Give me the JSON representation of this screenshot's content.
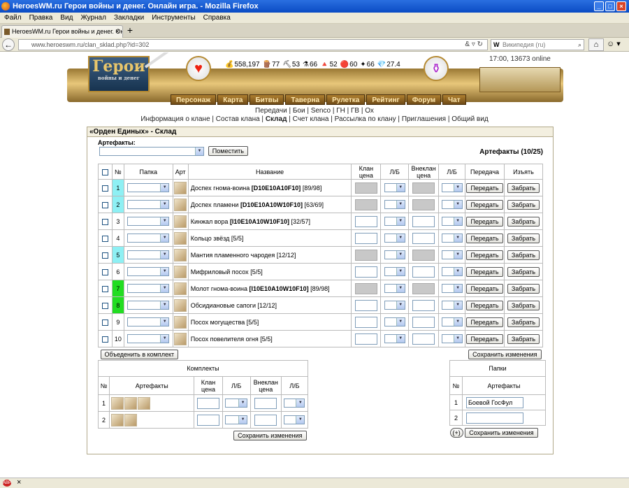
{
  "browser": {
    "window_title": "HeroesWM.ru Герои войны и денег. Онлайн игра. - Mozilla Firefox",
    "menu": [
      "Файл",
      "Правка",
      "Вид",
      "Журнал",
      "Закладки",
      "Инструменты",
      "Справка"
    ],
    "tab_title": "HeroesWM.ru Герои войны и денег. Онла...",
    "url_host": "www.heroeswm.ru",
    "url_path": "/clan_sklad.php?id=302",
    "search_placeholder": "Википедия (ru)",
    "search_engine": "W"
  },
  "game": {
    "clock": "17:00, 13673 online",
    "logo_title": "Герои",
    "logo_subtitle": "войны и денег",
    "resources": [
      {
        "icon": "gold-icon",
        "glyph": "💰",
        "value": "558,197"
      },
      {
        "icon": "wood-icon",
        "glyph": "🪵",
        "value": "77"
      },
      {
        "icon": "ore-icon",
        "glyph": "⛏",
        "value": "53"
      },
      {
        "icon": "mercury-icon",
        "glyph": "⚗",
        "value": "66"
      },
      {
        "icon": "sulfur-icon",
        "glyph": "🔺",
        "value": "52"
      },
      {
        "icon": "crystal-icon",
        "glyph": "🔴",
        "value": "60"
      },
      {
        "icon": "gems-icon",
        "glyph": "✦",
        "value": "66"
      },
      {
        "icon": "diamond-icon",
        "glyph": "💎",
        "value": "27.4"
      }
    ],
    "nav": [
      "Персонаж",
      "Карта",
      "Битвы",
      "Таверна",
      "Рулетка",
      "Рейтинг",
      "Форум",
      "Чат"
    ],
    "subnav1": [
      "Передачи",
      "Бои",
      "Senco",
      "ГН",
      "ГВ",
      "Ох"
    ],
    "subnav2": [
      "Информация о клане",
      "Состав клана",
      "Склад",
      "Счет клана",
      "Рассылка по клану",
      "Приглашения",
      "Общий вид"
    ],
    "subnav2_active": "Склад"
  },
  "storage": {
    "header": "«Орден Единых» - Склад",
    "artifacts_label": "Артефакты:",
    "place_button": "Поместить",
    "count_label": "Артефакты (10/25)",
    "columns": {
      "num": "№",
      "folder": "Папка",
      "art": "Арт",
      "name": "Название",
      "clan_price": "Клан цена",
      "lb": "Л/Б",
      "ext_price": "Внеклан цена",
      "lb2": "Л/Б",
      "transfer": "Передача",
      "withdraw": "Изъять"
    },
    "transfer_label": "Передать",
    "withdraw_label": "Забрать",
    "rows": [
      {
        "num": "1",
        "name": "Доспех гнома-воина",
        "code": "[D10E10A10F10]",
        "dur": "[89/98]",
        "num_color": "#8ef0f4",
        "disabled": true,
        "icon": "armor-icon"
      },
      {
        "num": "2",
        "name": "Доспех пламени",
        "code": "[D10E10A10W10F10]",
        "dur": "[63/69]",
        "num_color": "#8ef0f4",
        "disabled": true,
        "icon": "flame-armor-icon"
      },
      {
        "num": "3",
        "name": "Кинжал вора",
        "code": "[I10E10A10W10F10]",
        "dur": "[32/57]",
        "num_color": "",
        "disabled": false,
        "icon": "dagger-icon"
      },
      {
        "num": "4",
        "name": "Кольцо звёзд",
        "code": "",
        "dur": "[5/5]",
        "num_color": "",
        "disabled": false,
        "icon": "ring-icon"
      },
      {
        "num": "5",
        "name": "Мантия пламенного чародея",
        "code": "",
        "dur": "[12/12]",
        "num_color": "#8ef0f4",
        "disabled": true,
        "icon": "mantle-icon"
      },
      {
        "num": "6",
        "name": "Мифриловый посох",
        "code": "",
        "dur": "[5/5]",
        "num_color": "",
        "disabled": false,
        "icon": "staff-icon"
      },
      {
        "num": "7",
        "name": "Молот гнома-воина",
        "code": "[I10E10A10W10F10]",
        "dur": "[89/98]",
        "num_color": "#22dd22",
        "disabled": true,
        "icon": "hammer-icon"
      },
      {
        "num": "8",
        "name": "Обсидиановые сапоги",
        "code": "",
        "dur": "[12/12]",
        "num_color": "#22dd22",
        "disabled": false,
        "icon": "boots-icon"
      },
      {
        "num": "9",
        "name": "Посох могущества",
        "code": "",
        "dur": "[5/5]",
        "num_color": "",
        "disabled": false,
        "icon": "staff-icon"
      },
      {
        "num": "10",
        "name": "Посох повелителя огня",
        "code": "",
        "dur": "[5/5]",
        "num_color": "",
        "disabled": false,
        "icon": "fire-staff-icon"
      }
    ],
    "combine_button": "Объеденить в комплект",
    "save_button": "Сохранить изменения"
  },
  "sets": {
    "title": "Комплекты",
    "columns": {
      "num": "№",
      "artifacts": "Артефакты",
      "clan_price": "Клан цена",
      "lb": "Л/Б",
      "ext_price": "Внеклан цена",
      "lb2": "Л/Б"
    },
    "rows": [
      {
        "num": "1",
        "icons": [
          "armor-icon",
          "flame-armor-icon",
          "mantle-icon"
        ]
      },
      {
        "num": "2",
        "icons": [
          "hammer-icon",
          "boots-icon"
        ]
      }
    ],
    "save_button": "Сохранить изменения"
  },
  "folders": {
    "title": "Папки",
    "columns": {
      "num": "№",
      "artifacts": "Артефакты"
    },
    "rows": [
      {
        "num": "1",
        "value": "Боевой ГосФул"
      },
      {
        "num": "2",
        "value": ""
      }
    ],
    "add_button": "(+)",
    "save_button": "Сохранить изменения"
  },
  "colors": {
    "cyan_row": "#8ef0f4",
    "green_row": "#22dd22",
    "gold": "#b58a32"
  }
}
